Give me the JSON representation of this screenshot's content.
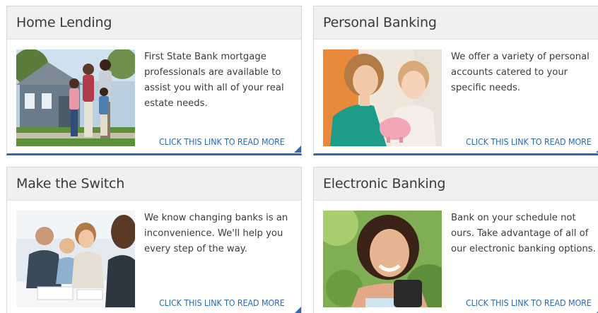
{
  "cards": [
    {
      "title": "Home Lending",
      "description": "First State Bank mortgage professionals are available to assist you with all of your real estate needs.",
      "link": "CLICK THIS LINK TO READ MORE"
    },
    {
      "title": "Personal Banking",
      "description": "We offer a variety of personal accounts catered to your specific needs.",
      "link": "CLICK THIS LINK TO READ MORE"
    },
    {
      "title": "Make the Switch",
      "description": "We know changing banks is an inconvenience. We'll help you every step of the way.",
      "link": "CLICK THIS LINK TO READ MORE"
    },
    {
      "title": "Electronic Banking",
      "description": "Bank on your schedule not ours.  Take advantage of all of our electronic banking options.",
      "link": "CLICK THIS LINK TO READ MORE"
    }
  ],
  "colors": {
    "accent": "#2b6cb0",
    "header_bg": "#f0f0f0",
    "text": "#3c3c3c"
  }
}
